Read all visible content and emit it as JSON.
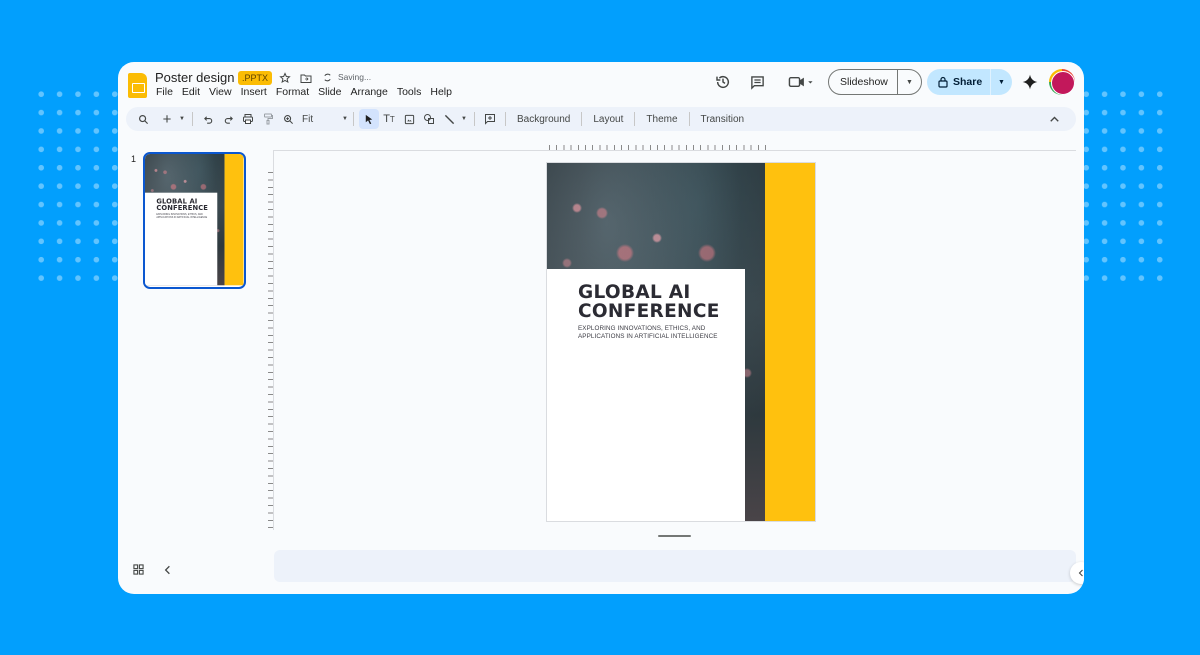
{
  "document": {
    "title": "Poster design",
    "format_badge": ".PPTX",
    "status": "Saving..."
  },
  "menu": [
    "File",
    "Edit",
    "View",
    "Insert",
    "Format",
    "Slide",
    "Arrange",
    "Tools",
    "Help"
  ],
  "header_actions": {
    "slideshow_label": "Slideshow",
    "share_label": "Share"
  },
  "toolbar": {
    "zoom_value": "Fit",
    "text_buttons": [
      "Background",
      "Layout",
      "Theme",
      "Transition"
    ]
  },
  "filmstrip": {
    "slides": [
      {
        "number": "1",
        "selected": true
      }
    ]
  },
  "slide": {
    "headline_line1": "GLOBAL AI",
    "headline_line2": "CONFERENCE",
    "subtitle_line1": "EXPLORING INNOVATIONS, ETHICS, AND",
    "subtitle_line2": "APPLICATIONS IN ARTIFICIAL INTELLIGENCE"
  },
  "colors": {
    "background": "#029ffd",
    "accent_yellow": "#ffc10e",
    "share_button": "#c2e7ff",
    "selection_blue": "#0b57d0",
    "avatar": "#c2185b"
  }
}
